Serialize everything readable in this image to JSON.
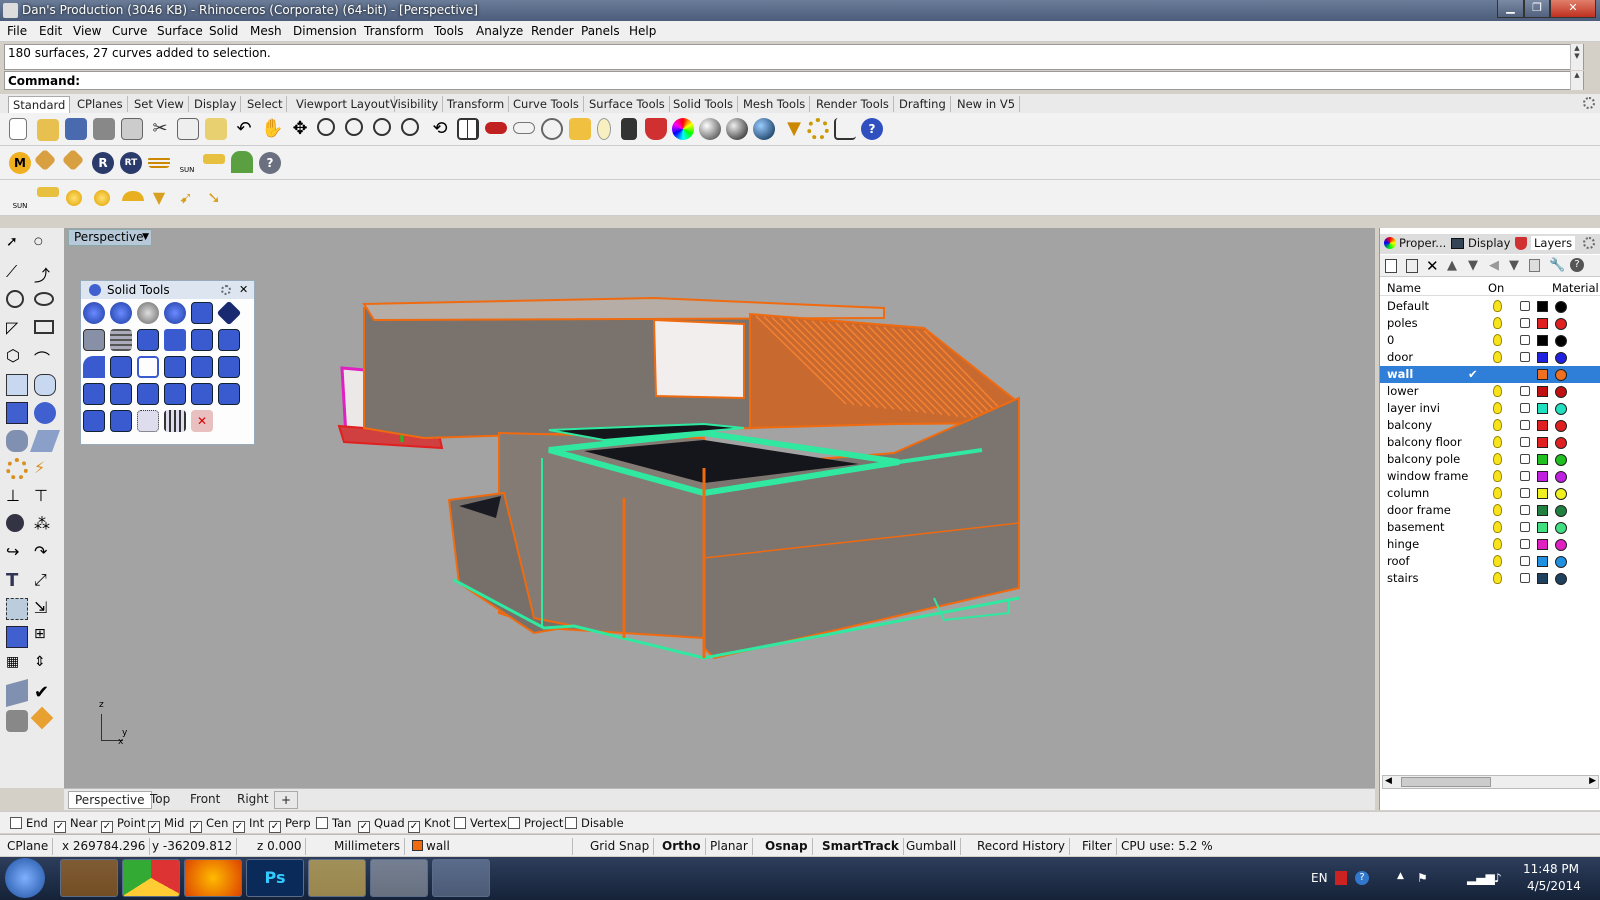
{
  "window": {
    "title": "Dan's Production (3046 KB) - Rhinoceros (Corporate) (64-bit) - [Perspective]"
  },
  "menu": [
    "File",
    "Edit",
    "View",
    "Curve",
    "Surface",
    "Solid",
    "Mesh",
    "Dimension",
    "Transform",
    "Tools",
    "Analyze",
    "Render",
    "Panels",
    "Help"
  ],
  "command": {
    "history": "180 surfaces, 27 curves added to selection.",
    "prompt": "Command:"
  },
  "toolbar_tabs": [
    "Standard",
    "CPlanes",
    "Set View",
    "Display",
    "Select",
    "Viewport Layout",
    "Visibility",
    "Transform",
    "Curve Tools",
    "Surface Tools",
    "Solid Tools",
    "Mesh Tools",
    "Render Tools",
    "Drafting",
    "New in V5"
  ],
  "viewport": {
    "label": "Perspective",
    "axis_x": "x",
    "axis_y": "y",
    "axis_z": "z",
    "tabs": [
      "Perspective",
      "Top",
      "Front",
      "Right"
    ]
  },
  "solid_panel": {
    "title": "Solid Tools"
  },
  "right_panel": {
    "tabs": [
      "Proper...",
      "Display",
      "Layers"
    ],
    "columns": {
      "name": "Name",
      "on": "On",
      "material": "Material"
    },
    "layers": [
      {
        "name": "Default",
        "color": "#000000",
        "selected": false
      },
      {
        "name": "poles",
        "color": "#e02020",
        "selected": false
      },
      {
        "name": "0",
        "color": "#000000",
        "selected": false
      },
      {
        "name": "door",
        "color": "#2020e0",
        "selected": false
      },
      {
        "name": "wall",
        "color": "#f07020",
        "selected": true,
        "check": "✔"
      },
      {
        "name": "lower",
        "color": "#c01010",
        "selected": false
      },
      {
        "name": "layer invi",
        "color": "#20e0c0",
        "selected": false
      },
      {
        "name": "balcony",
        "color": "#e02020",
        "selected": false
      },
      {
        "name": "balcony floor",
        "color": "#e02020",
        "selected": false
      },
      {
        "name": "balcony pole",
        "color": "#20c020",
        "selected": false
      },
      {
        "name": "window frame",
        "color": "#c020e0",
        "selected": false
      },
      {
        "name": "column",
        "color": "#f0f020",
        "selected": false
      },
      {
        "name": "door frame",
        "color": "#208040",
        "selected": false
      },
      {
        "name": "basement",
        "color": "#40e080",
        "selected": false
      },
      {
        "name": "hinge",
        "color": "#e020c0",
        "selected": false
      },
      {
        "name": "roof",
        "color": "#2090e0",
        "selected": false
      },
      {
        "name": "stairs",
        "color": "#204060",
        "selected": false
      }
    ]
  },
  "osnap": [
    {
      "label": "End",
      "checked": false
    },
    {
      "label": "Near",
      "checked": true
    },
    {
      "label": "Point",
      "checked": true
    },
    {
      "label": "Mid",
      "checked": true
    },
    {
      "label": "Cen",
      "checked": true
    },
    {
      "label": "Int",
      "checked": true
    },
    {
      "label": "Perp",
      "checked": true
    },
    {
      "label": "Tan",
      "checked": false
    },
    {
      "label": "Quad",
      "checked": true
    },
    {
      "label": "Knot",
      "checked": true
    },
    {
      "label": "Vertex",
      "checked": false
    },
    {
      "label": "Project",
      "checked": false
    },
    {
      "label": "Disable",
      "checked": false
    }
  ],
  "status": {
    "cplane": "CPlane",
    "x": "x 269784.296",
    "y": "y -36209.812",
    "z": "z 0.000",
    "units": "Millimeters",
    "layer": "wall",
    "layer_color": "#f07020",
    "grid_snap": "Grid Snap",
    "ortho": "Ortho",
    "planar": "Planar",
    "osnap": "Osnap",
    "smarttrack": "SmartTrack",
    "gumball": "Gumball",
    "record_history": "Record History",
    "filter": "Filter",
    "cpu": "CPU use: 5.2 %"
  },
  "taskbar": {
    "lang": "EN",
    "time": "11:48 PM",
    "date": "4/5/2014"
  },
  "sun_label": "SUN",
  "colors": {
    "accent_orange": "#f06a10",
    "accent_green": "#30e8a0",
    "selection_blue": "#2f7fd8"
  }
}
